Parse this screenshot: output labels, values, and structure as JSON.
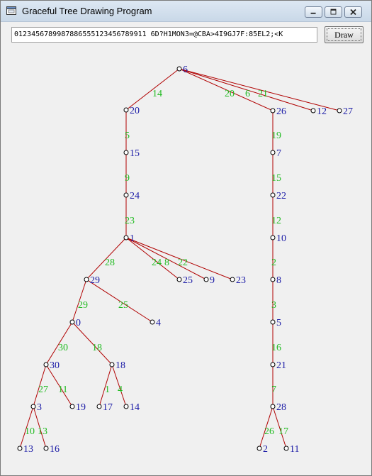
{
  "window": {
    "title": "Graceful Tree Drawing Program",
    "icon": "window-app-icon"
  },
  "controls": {
    "minimize_icon": "minimize-icon",
    "maximize_icon": "maximize-icon",
    "close_icon": "close-icon"
  },
  "input": {
    "value": "0123456789987886555123456789911 6D?H1MON3=@CBA>4I9GJ7F:85EL2;<K"
  },
  "button": {
    "label": "Draw"
  },
  "colors": {
    "edge": "#b00000",
    "node_label": "#1a1aa6",
    "edge_label": "#22bb22"
  },
  "tree": {
    "nodes": [
      {
        "id": "n6",
        "label": "6"
      },
      {
        "id": "n20",
        "label": "20"
      },
      {
        "id": "n26",
        "label": "26"
      },
      {
        "id": "n12",
        "label": "12"
      },
      {
        "id": "n27",
        "label": "27"
      },
      {
        "id": "n15",
        "label": "15"
      },
      {
        "id": "n7",
        "label": "7"
      },
      {
        "id": "n24",
        "label": "24"
      },
      {
        "id": "n22",
        "label": "22"
      },
      {
        "id": "n1",
        "label": "1"
      },
      {
        "id": "n10",
        "label": "10"
      },
      {
        "id": "n29",
        "label": "29"
      },
      {
        "id": "n25",
        "label": "25"
      },
      {
        "id": "n9",
        "label": "9"
      },
      {
        "id": "n23",
        "label": "23"
      },
      {
        "id": "n8",
        "label": "8"
      },
      {
        "id": "n0",
        "label": "0"
      },
      {
        "id": "n4",
        "label": "4"
      },
      {
        "id": "n5",
        "label": "5"
      },
      {
        "id": "n30",
        "label": "30"
      },
      {
        "id": "n18",
        "label": "18"
      },
      {
        "id": "n21",
        "label": "21"
      },
      {
        "id": "n3",
        "label": "3"
      },
      {
        "id": "n19",
        "label": "19"
      },
      {
        "id": "n17",
        "label": "17"
      },
      {
        "id": "n14",
        "label": "14"
      },
      {
        "id": "n28",
        "label": "28"
      },
      {
        "id": "n13",
        "label": "13"
      },
      {
        "id": "n16",
        "label": "16"
      },
      {
        "id": "n2",
        "label": "2"
      },
      {
        "id": "n11",
        "label": "11"
      }
    ],
    "edges": [
      {
        "from": "n6",
        "to": "n20",
        "label": "14"
      },
      {
        "from": "n6",
        "to": "n26",
        "label": "20"
      },
      {
        "from": "n6",
        "to": "n12",
        "label": "6"
      },
      {
        "from": "n6",
        "to": "n27",
        "label": "21"
      },
      {
        "from": "n20",
        "to": "n15",
        "label": "5"
      },
      {
        "from": "n15",
        "to": "n24",
        "label": "9"
      },
      {
        "from": "n24",
        "to": "n1",
        "label": "23"
      },
      {
        "from": "n1",
        "to": "n29",
        "label": "28"
      },
      {
        "from": "n1",
        "to": "n25",
        "label": "24"
      },
      {
        "from": "n1",
        "to": "n9",
        "label": "8"
      },
      {
        "from": "n1",
        "to": "n23",
        "label": "22"
      },
      {
        "from": "n29",
        "to": "n0",
        "label": "29"
      },
      {
        "from": "n29",
        "to": "n4",
        "label": "25"
      },
      {
        "from": "n0",
        "to": "n30",
        "label": "30"
      },
      {
        "from": "n0",
        "to": "n18",
        "label": "18"
      },
      {
        "from": "n30",
        "to": "n3",
        "label": "27"
      },
      {
        "from": "n30",
        "to": "n19",
        "label": "11"
      },
      {
        "from": "n18",
        "to": "n17",
        "label": "1"
      },
      {
        "from": "n18",
        "to": "n14",
        "label": "4"
      },
      {
        "from": "n3",
        "to": "n13",
        "label": "10"
      },
      {
        "from": "n3",
        "to": "n16",
        "label": "13"
      },
      {
        "from": "n26",
        "to": "n7",
        "label": "19"
      },
      {
        "from": "n7",
        "to": "n22",
        "label": "15"
      },
      {
        "from": "n22",
        "to": "n10",
        "label": "12"
      },
      {
        "from": "n10",
        "to": "n8",
        "label": "2"
      },
      {
        "from": "n8",
        "to": "n5",
        "label": "3"
      },
      {
        "from": "n5",
        "to": "n21",
        "label": "16"
      },
      {
        "from": "n21",
        "to": "n28",
        "label": "7"
      },
      {
        "from": "n28",
        "to": "n2",
        "label": "26"
      },
      {
        "from": "n28",
        "to": "n11",
        "label": "17"
      }
    ]
  }
}
